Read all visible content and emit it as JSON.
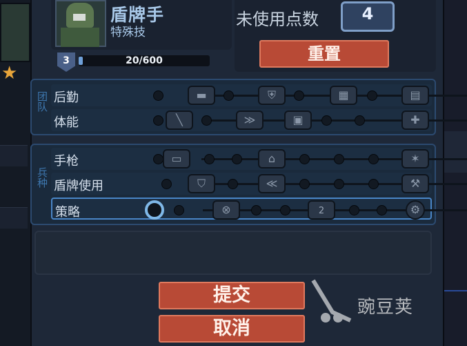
{
  "header": {
    "class_name": "盾牌手",
    "subtitle": "特殊技",
    "level": "3",
    "xp_text": "20/600",
    "xp_progress": 0.033
  },
  "points": {
    "label": "未使用点数",
    "value": "4"
  },
  "buttons": {
    "reset": "重置",
    "submit": "提交",
    "cancel": "取消"
  },
  "sections": {
    "team_label": "团队",
    "unit_label": "兵种"
  },
  "rows": [
    {
      "label": "后勤",
      "nodes": [
        "ammo-icon",
        "shield-plus-icon",
        "grid-icon",
        "supply-icon"
      ]
    },
    {
      "label": "体能",
      "nodes": [
        "knife-icon",
        "run-icon",
        "armor-icon",
        "medkit-icon"
      ]
    },
    {
      "label": "手枪",
      "nodes": [
        "pistol-icon",
        "helmet-icon",
        "burst-icon"
      ]
    },
    {
      "label": "盾牌使用",
      "nodes": [
        "shield-icon",
        "chevron-icon",
        "wrench-icon"
      ]
    },
    {
      "label": "策略",
      "nodes": [
        "start-node",
        "cannon-icon",
        "double-icon",
        "gear-shield-icon"
      ],
      "node_texts": [
        "",
        "",
        "2",
        ""
      ]
    }
  ],
  "watermark": {
    "text": "豌豆荚"
  },
  "colors": {
    "button_red": "#b84a36",
    "accent_blue": "#7fb8e8",
    "panel": "#1e2838"
  }
}
